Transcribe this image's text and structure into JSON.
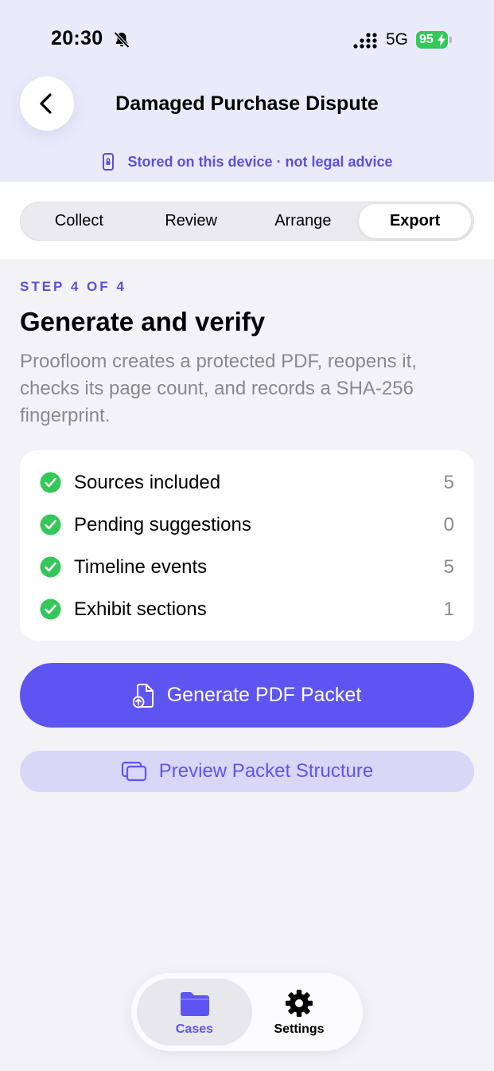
{
  "status_bar": {
    "time": "20:30",
    "network": "5G",
    "battery": "95"
  },
  "nav": {
    "back_icon": "chevron-left-icon",
    "title": "Damaged Purchase Dispute",
    "device_note": "Stored on this device · not legal advice"
  },
  "segments": [
    {
      "label": "Collect",
      "active": false
    },
    {
      "label": "Review",
      "active": false
    },
    {
      "label": "Arrange",
      "active": false
    },
    {
      "label": "Export",
      "active": true
    }
  ],
  "step": {
    "label": "STEP 4 OF 4",
    "title": "Generate and verify",
    "description": "Proofloom creates a protected PDF, reopens it, checks its page count, and records a SHA-256 fingerprint."
  },
  "checklist": [
    {
      "label": "Sources included",
      "value": "5"
    },
    {
      "label": "Pending suggestions",
      "value": "0"
    },
    {
      "label": "Timeline events",
      "value": "5"
    },
    {
      "label": "Exhibit sections",
      "value": "1"
    }
  ],
  "actions": {
    "generate_label": "Generate PDF Packet",
    "preview_label": "Preview Packet Structure"
  },
  "tab_bar": {
    "cases_label": "Cases",
    "settings_label": "Settings",
    "active": "Cases"
  },
  "colors": {
    "accent": "#5e54f2",
    "success": "#34c759",
    "header_background": "#ebeafb",
    "secondary_button": "#d9d7f6"
  }
}
